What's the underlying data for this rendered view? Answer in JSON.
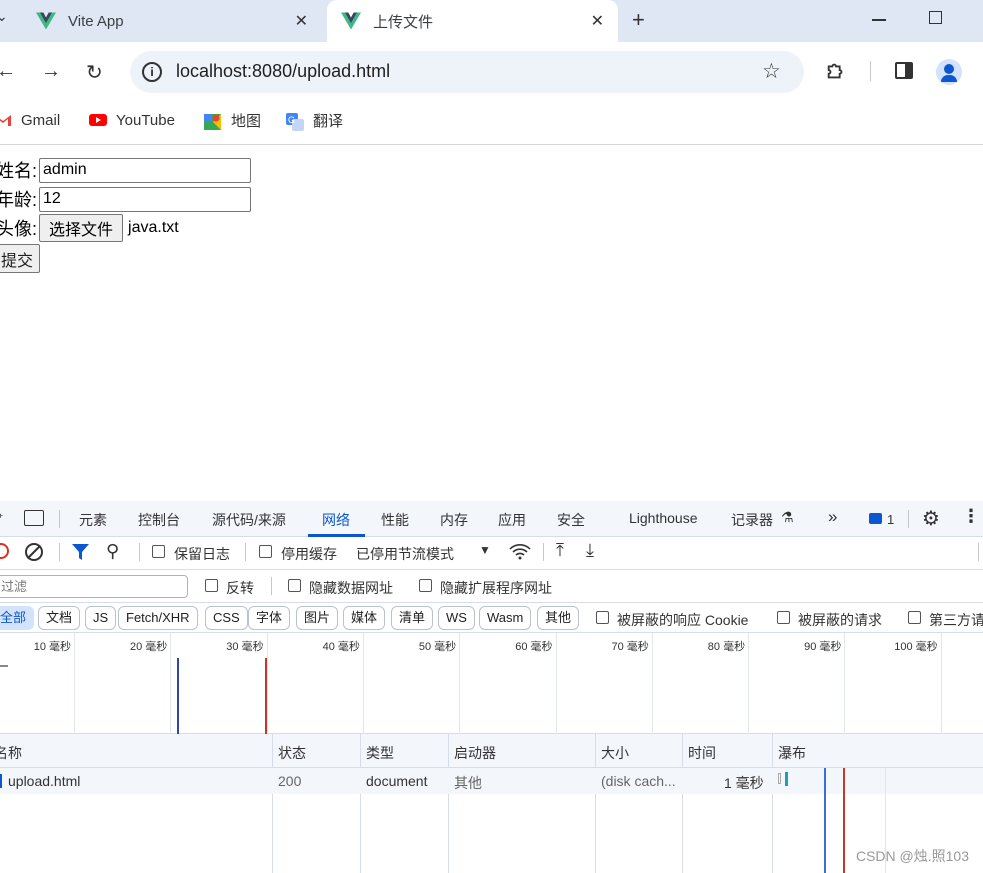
{
  "browser": {
    "tabs": [
      {
        "title": "Vite App",
        "active": false
      },
      {
        "title": "上传文件",
        "active": true
      }
    ],
    "url": "localhost:8080/upload.html",
    "bookmarks": [
      {
        "label": "Gmail",
        "icon": "gmail-icon"
      },
      {
        "label": "YouTube",
        "icon": "youtube-icon"
      },
      {
        "label": "地图",
        "icon": "maps-icon"
      },
      {
        "label": "翻译",
        "icon": "translate-icon"
      }
    ]
  },
  "form": {
    "name_label": "姓名:",
    "name_value": "admin",
    "age_label": "年龄:",
    "age_value": "12",
    "avatar_label": "头像:",
    "file_button": "选择文件",
    "file_name": "java.txt",
    "submit_label": "提交"
  },
  "devtools": {
    "tabs": [
      "元素",
      "控制台",
      "源代码/来源",
      "网络",
      "性能",
      "内存",
      "应用",
      "安全",
      "Lighthouse",
      "记录器"
    ],
    "active_tab": "网络",
    "issues_count": "1",
    "toolbar": {
      "preserve_log": "保留日志",
      "disable_cache": "停用缓存",
      "throttle": "已停用节流模式"
    },
    "filter": {
      "placeholder": "过滤",
      "invert": "反转",
      "hide_data_urls": "隐藏数据网址",
      "hide_ext_urls": "隐藏扩展程序网址"
    },
    "types": [
      "全部",
      "文档",
      "JS",
      "Fetch/XHR",
      "CSS",
      "字体",
      "图片",
      "媒体",
      "清单",
      "WS",
      "Wasm",
      "其他"
    ],
    "extra_filters": {
      "blocked_cookies": "被屏蔽的响应 Cookie",
      "blocked_requests": "被屏蔽的请求",
      "third_party": "第三方请"
    },
    "timeline_ticks": [
      "10 毫秒",
      "20 毫秒",
      "30 毫秒",
      "40 毫秒",
      "50 毫秒",
      "60 毫秒",
      "70 毫秒",
      "80 毫秒",
      "90 毫秒",
      "100 毫秒"
    ],
    "columns": [
      "名称",
      "状态",
      "类型",
      "启动器",
      "大小",
      "时间",
      "瀑布"
    ],
    "requests": [
      {
        "name": "upload.html",
        "status": "200",
        "type": "document",
        "initiator": "其他",
        "size": "(disk cach...",
        "time": "1 毫秒"
      }
    ]
  },
  "watermark": "CSDN @烛.照103",
  "colors": {
    "accent": "#0b57d0",
    "vue_green": "#41b883",
    "vue_dark": "#35495e",
    "load_line": "#c0392b",
    "dcl_line": "#3344aa"
  }
}
